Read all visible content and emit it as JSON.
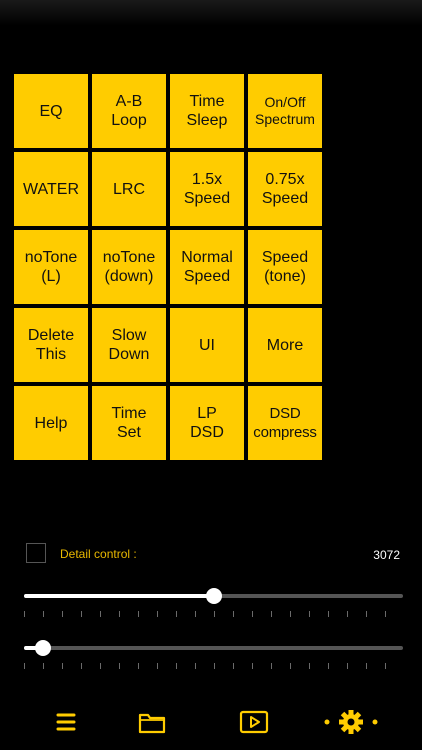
{
  "buttons": [
    {
      "label": "EQ",
      "name": "eq-button"
    },
    {
      "label": "A-B\nLoop",
      "name": "ab-loop-button"
    },
    {
      "label": "Time\nSleep",
      "name": "time-sleep-button"
    },
    {
      "label": "On/Off\nSpectrum",
      "name": "spectrum-toggle-button",
      "small": true
    },
    {
      "label": "WATER",
      "name": "water-button"
    },
    {
      "label": "LRC",
      "name": "lrc-button"
    },
    {
      "label": "1.5x\nSpeed",
      "name": "speed-1-5x-button"
    },
    {
      "label": "0.75x\nSpeed",
      "name": "speed-0-75x-button"
    },
    {
      "label": "noTone\n(L)",
      "name": "notone-l-button"
    },
    {
      "label": "noTone\n(down)",
      "name": "notone-down-button"
    },
    {
      "label": "Normal\nSpeed",
      "name": "normal-speed-button"
    },
    {
      "label": "Speed\n(tone)",
      "name": "speed-tone-button"
    },
    {
      "label": "Delete\nThis",
      "name": "delete-this-button"
    },
    {
      "label": "Slow\nDown",
      "name": "slow-down-button"
    },
    {
      "label": "UI",
      "name": "ui-button"
    },
    {
      "label": "More",
      "name": "more-button"
    },
    {
      "label": "Help",
      "name": "help-button"
    },
    {
      "label": "Time\nSet",
      "name": "time-set-button"
    },
    {
      "label": "LP\nDSD",
      "name": "lp-dsd-button"
    },
    {
      "label": "DSD\ncompress",
      "name": "dsd-compress-button",
      "tight": true
    }
  ],
  "detail": {
    "label": "Detail control :",
    "value": "3072",
    "checked": false
  },
  "sliders": [
    {
      "name": "detail-slider",
      "value": 0.5
    },
    {
      "name": "secondary-slider",
      "value": 0.05
    }
  ],
  "tabbar": {
    "items": [
      {
        "icon": "list-icon",
        "active": false
      },
      {
        "icon": "folder-icon",
        "active": false
      },
      {
        "icon": "play-icon",
        "active": false
      },
      {
        "icon": "gear-icon",
        "active": true
      }
    ]
  },
  "colors": {
    "accent": "#FFCC00",
    "label": "#E8B800",
    "background": "#000000",
    "track": "#555555"
  }
}
